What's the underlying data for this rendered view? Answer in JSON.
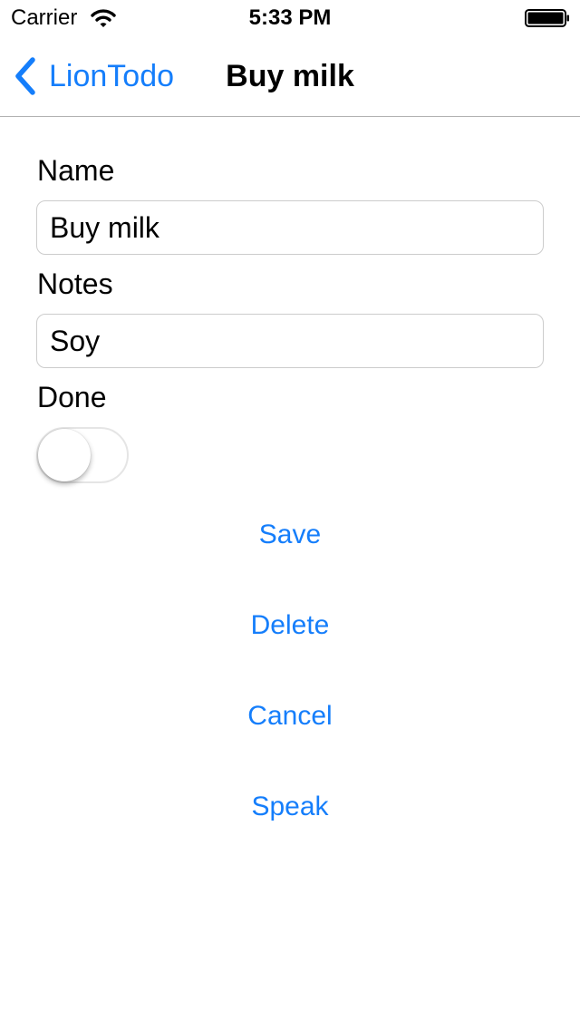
{
  "status_bar": {
    "carrier": "Carrier",
    "time": "5:33 PM",
    "wifi_icon": "wifi-icon",
    "battery_icon": "battery-icon"
  },
  "nav": {
    "back_label": "LionTodo",
    "back_icon": "chevron-left-icon",
    "title": "Buy milk"
  },
  "form": {
    "name_label": "Name",
    "name_value": "Buy milk",
    "notes_label": "Notes",
    "notes_value": "Soy",
    "done_label": "Done",
    "done_on": false
  },
  "actions": {
    "save": "Save",
    "delete": "Delete",
    "cancel": "Cancel",
    "speak": "Speak"
  },
  "colors": {
    "accent": "#157efb",
    "separator": "#b2b2b2",
    "field_border": "#cccccc"
  }
}
